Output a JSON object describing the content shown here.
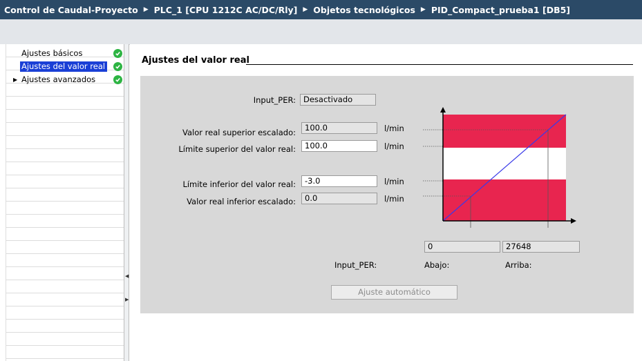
{
  "breadcrumb": [
    "Control de Caudal-Proyecto",
    "PLC_1 [CPU 1212C AC/DC/Rly]",
    "Objetos tecnológicos",
    "PID_Compact_prueba1 [DB5]"
  ],
  "nav": {
    "items": [
      {
        "label": "Ajustes básicos",
        "status": "ok"
      },
      {
        "label": "Ajustes del valor real",
        "status": "ok"
      },
      {
        "label": "Ajustes avanzados",
        "status": "ok"
      }
    ]
  },
  "section": {
    "title": "Ajustes del valor real"
  },
  "form": {
    "input_per_label": "Input_PER:",
    "input_per_value": "Desactivado",
    "upper_scaled_label": "Valor real superior escalado:",
    "upper_scaled_value": "100.0",
    "upper_limit_label": "Límite superior del valor real:",
    "upper_limit_value": "100.0",
    "lower_limit_label": "Límite inferior del valor real:",
    "lower_limit_value": "-3.0",
    "lower_scaled_label": "Valor real inferior escalado:",
    "lower_scaled_value": "0.0",
    "unit": "l/min"
  },
  "scaling": {
    "input_per_label": "Input_PER:",
    "low_label": "Abajo:",
    "low_value": "0",
    "high_label": "Arriba:",
    "high_value": "27648"
  },
  "auto_button_label": "Ajuste automático",
  "colors": {
    "title_bar": "#2b4a67",
    "limit_zone": "#e8254f",
    "check": "#2db443",
    "selection": "#1a3fd6"
  }
}
